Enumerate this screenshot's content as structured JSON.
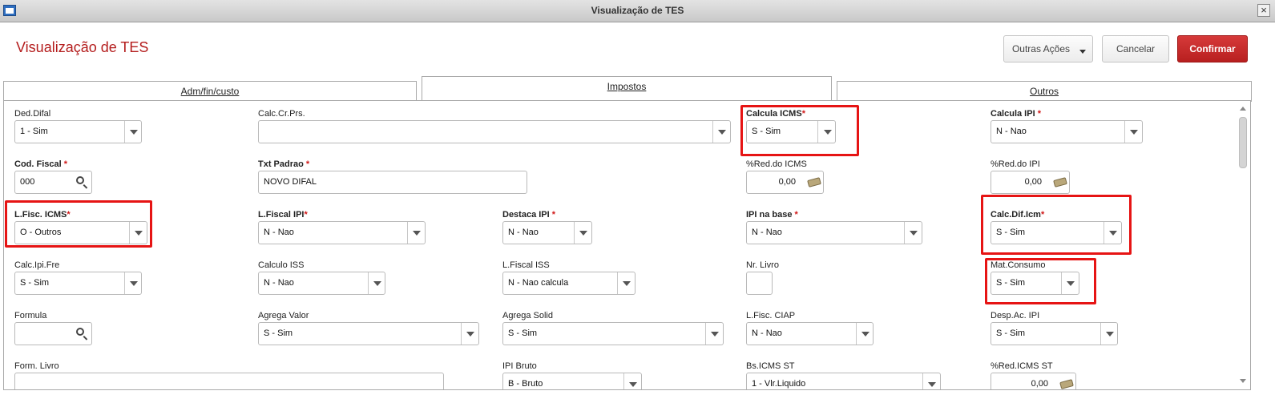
{
  "window": {
    "title": "Visualização de TES"
  },
  "header": {
    "title": "Visualização de TES",
    "buttons": {
      "more": "Outras Ações",
      "cancel": "Cancelar",
      "confirm": "Confirmar"
    }
  },
  "tabs": [
    {
      "label": "Adm/fin/custo",
      "active": false
    },
    {
      "label": "Impostos",
      "active": true
    },
    {
      "label": "Outros",
      "active": false
    }
  ],
  "colors": {
    "accent": "#b41d1d",
    "confirm": "#c62828",
    "highlight": "#e61414",
    "required": "#d01818"
  },
  "fields": {
    "ded_difal": {
      "label": "Ded.Difal",
      "value": "1 - Sim"
    },
    "calc_cr_prs": {
      "label": "Calc.Cr.Prs.",
      "value": ""
    },
    "calcula_icms": {
      "label": "Calcula ICMS",
      "value": "S - Sim",
      "required": true,
      "highlighted": true
    },
    "calcula_ipi": {
      "label": "Calcula IPI ",
      "value": "N - Nao",
      "required": true
    },
    "cod_fiscal": {
      "label": "Cod. Fiscal ",
      "value": "000",
      "required": true
    },
    "txt_padrao": {
      "label": "Txt Padrao ",
      "value": "NOVO DIFAL",
      "required": true
    },
    "red_icms": {
      "label": "%Red.do ICMS",
      "value": "0,00"
    },
    "red_ipi": {
      "label": "%Red.do IPI",
      "value": "0,00"
    },
    "l_fisc_icms": {
      "label": "L.Fisc. ICMS",
      "value": "O - Outros",
      "required": true,
      "highlighted": true
    },
    "l_fiscal_ipi": {
      "label": "L.Fiscal IPI",
      "value": "N - Nao",
      "required": true
    },
    "destaca_ipi": {
      "label": "Destaca IPI ",
      "value": "N - Nao",
      "required": true
    },
    "ipi_na_base": {
      "label": "IPI na base ",
      "value": "N - Nao",
      "required": true
    },
    "calc_dif_icm": {
      "label": "Calc.Dif.Icm",
      "value": "S - Sim",
      "required": true,
      "highlighted": true
    },
    "calc_ipi_fre": {
      "label": "Calc.Ipi.Fre",
      "value": "S - Sim"
    },
    "calculo_iss": {
      "label": "Calculo ISS",
      "value": "N - Nao"
    },
    "l_fiscal_iss": {
      "label": "L.Fiscal ISS",
      "value": "N - Nao calcula"
    },
    "nr_livro": {
      "label": "Nr. Livro",
      "value": ""
    },
    "mat_consumo": {
      "label": "Mat.Consumo",
      "value": "S - Sim",
      "highlighted": true
    },
    "formula": {
      "label": "Formula",
      "value": ""
    },
    "agrega_valor": {
      "label": "Agrega Valor",
      "value": "S - Sim"
    },
    "agrega_solid": {
      "label": "Agrega Solid",
      "value": "S - Sim"
    },
    "l_fisc_ciap": {
      "label": "L.Fisc. CIAP",
      "value": "N - Nao"
    },
    "desp_ac_ipi": {
      "label": "Desp.Ac. IPI",
      "value": "S - Sim"
    },
    "form_livro": {
      "label": "Form. Livro",
      "value": ""
    },
    "ipi_bruto": {
      "label": "IPI Bruto",
      "value": "B - Bruto"
    },
    "bs_icms_st": {
      "label": "Bs.ICMS ST",
      "value": "1 - Vlr.Liquido"
    },
    "red_icms_st": {
      "label": "%Red.ICMS ST",
      "value": "0,00"
    }
  }
}
